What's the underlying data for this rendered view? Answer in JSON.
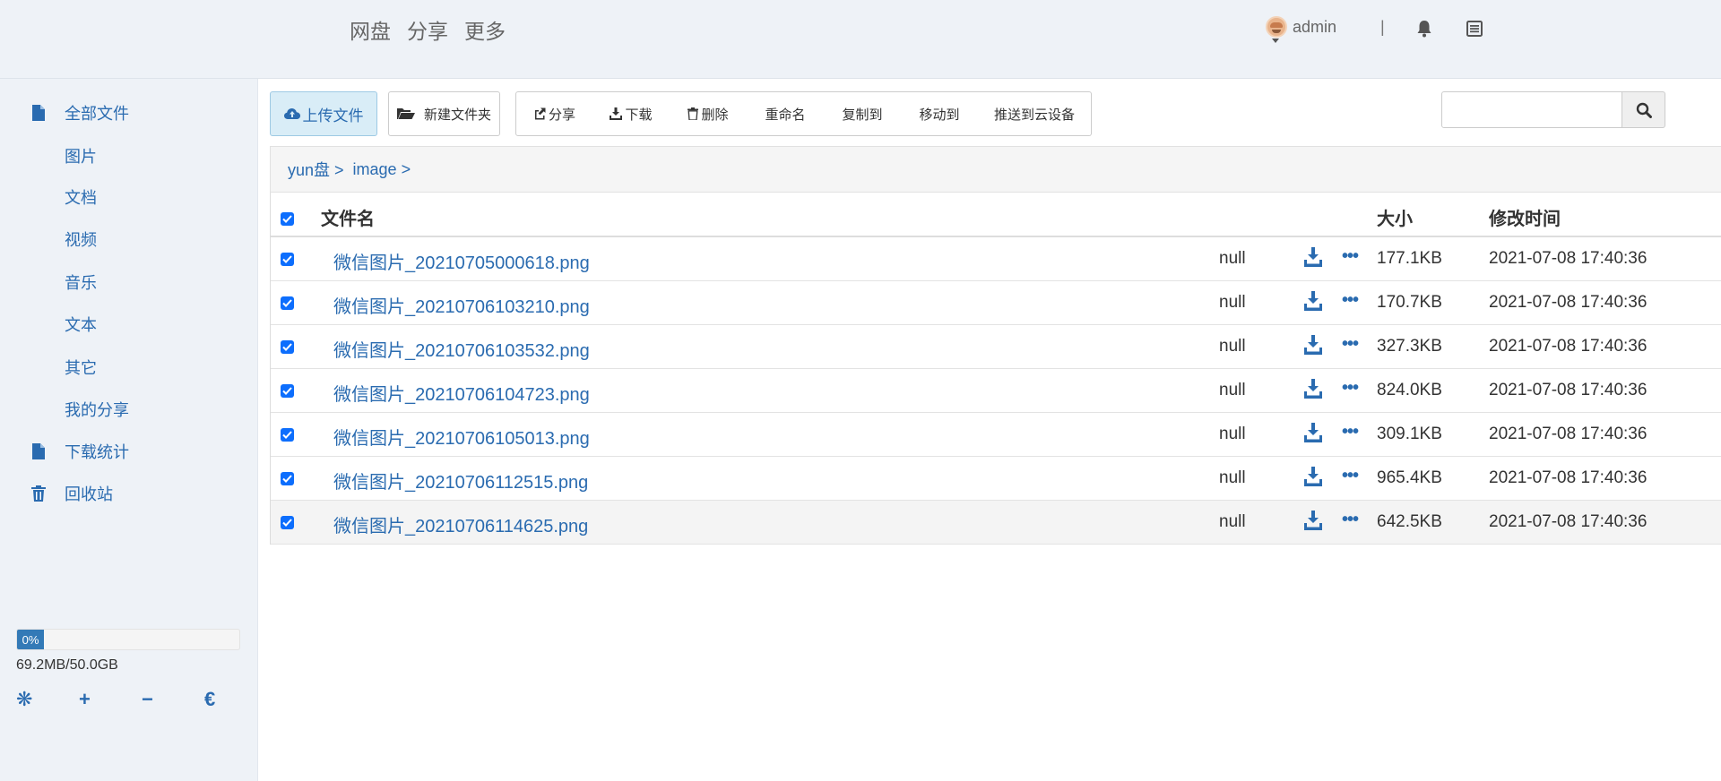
{
  "header": {
    "nav": [
      "网盘",
      "分享",
      "更多"
    ],
    "username": "admin",
    "separator": "|"
  },
  "sidebar": {
    "items": [
      {
        "label": "全部文件",
        "icon": "file-icon",
        "level": "top"
      },
      {
        "label": "图片",
        "level": "sub"
      },
      {
        "label": "文档",
        "level": "sub"
      },
      {
        "label": "视频",
        "level": "sub"
      },
      {
        "label": "音乐",
        "level": "sub"
      },
      {
        "label": "文本",
        "level": "sub"
      },
      {
        "label": "其它",
        "level": "sub"
      },
      {
        "label": "我的分享",
        "level": "sub"
      },
      {
        "label": "下载统计",
        "icon": "file-icon",
        "level": "top"
      },
      {
        "label": "回收站",
        "icon": "trash-icon",
        "level": "top"
      }
    ],
    "quota": {
      "percent_label": "0%",
      "percent": 0,
      "text": "69.2MB/50.0GB"
    },
    "tools": [
      "❋",
      "+",
      "−",
      "€"
    ]
  },
  "toolbar": {
    "upload": "上传文件",
    "new_folder": "新建文件夹",
    "share": "分享",
    "download": "下载",
    "delete": "删除",
    "rename": "重命名",
    "copy_to": "复制到",
    "move_to": "移动到",
    "push_cloud": "推送到云设备"
  },
  "search": {
    "placeholder": ""
  },
  "breadcrumb": [
    "yun盘 >",
    "image >"
  ],
  "table": {
    "headers": {
      "name": "文件名",
      "size": "大小",
      "modified": "修改时间"
    },
    "rows": [
      {
        "name": "微信图片_20210705000618.png",
        "extra": "null",
        "size": "177.1KB",
        "modified": "2021-07-08 17:40:36"
      },
      {
        "name": "微信图片_20210706103210.png",
        "extra": "null",
        "size": "170.7KB",
        "modified": "2021-07-08 17:40:36"
      },
      {
        "name": "微信图片_20210706103532.png",
        "extra": "null",
        "size": "327.3KB",
        "modified": "2021-07-08 17:40:36"
      },
      {
        "name": "微信图片_20210706104723.png",
        "extra": "null",
        "size": "824.0KB",
        "modified": "2021-07-08 17:40:36"
      },
      {
        "name": "微信图片_20210706105013.png",
        "extra": "null",
        "size": "309.1KB",
        "modified": "2021-07-08 17:40:36"
      },
      {
        "name": "微信图片_20210706112515.png",
        "extra": "null",
        "size": "965.4KB",
        "modified": "2021-07-08 17:40:36"
      },
      {
        "name": "微信图片_20210706114625.png",
        "extra": "null",
        "size": "642.5KB",
        "modified": "2021-07-08 17:40:36"
      }
    ]
  },
  "colors": {
    "link": "#2a6bb0",
    "header_bg": "#eef2f7",
    "upload_bg": "#d9edf7",
    "checkbox": "#0d6efd",
    "progress": "#337ab7"
  }
}
